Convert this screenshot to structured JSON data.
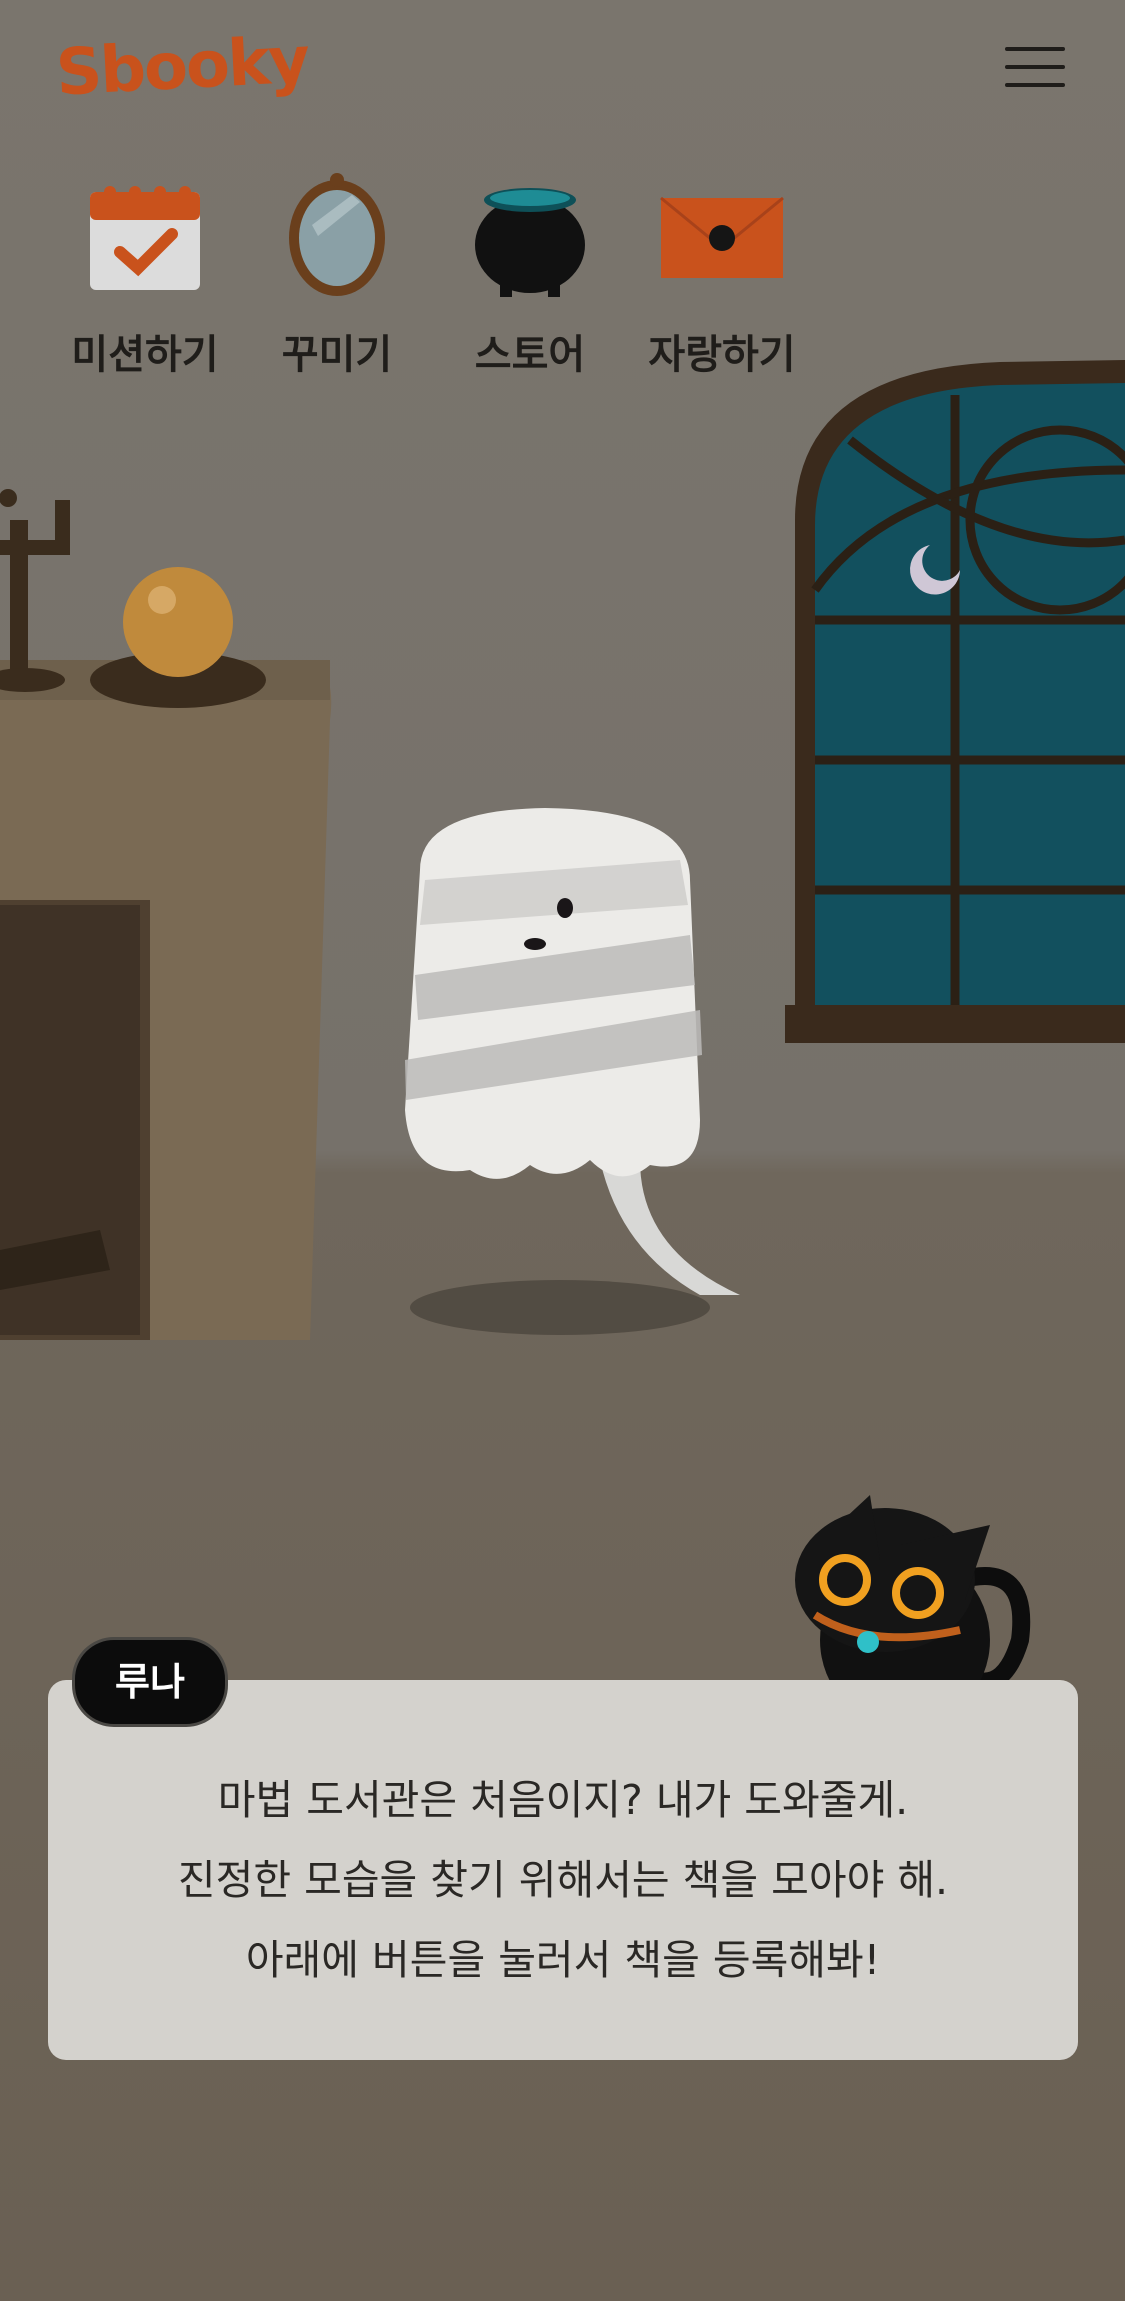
{
  "app": {
    "logo_text": "Sbooky"
  },
  "header": {
    "menu_icon": "hamburger-menu-icon"
  },
  "nav": {
    "items": [
      {
        "label": "미션하기",
        "icon": "calendar-check-icon"
      },
      {
        "label": "꾸미기",
        "icon": "mirror-icon"
      },
      {
        "label": "스토어",
        "icon": "cauldron-icon"
      },
      {
        "label": "자랑하기",
        "icon": "envelope-icon"
      }
    ]
  },
  "dialog": {
    "speaker": "루나",
    "lines": [
      "마법 도서관은 처음이지? 내가 도와줄게.",
      "진정한 모습을 찾기 위해서는 책을 모아야 해.",
      "아래에 버튼을 눌러서 책을 등록해봐!"
    ]
  },
  "colors": {
    "brand": "#c9521c",
    "wall": "#7a756d",
    "floor": "#6a6053",
    "dialog_bg": "#d4d2cd",
    "speaker_bg": "#0c0c0c"
  }
}
